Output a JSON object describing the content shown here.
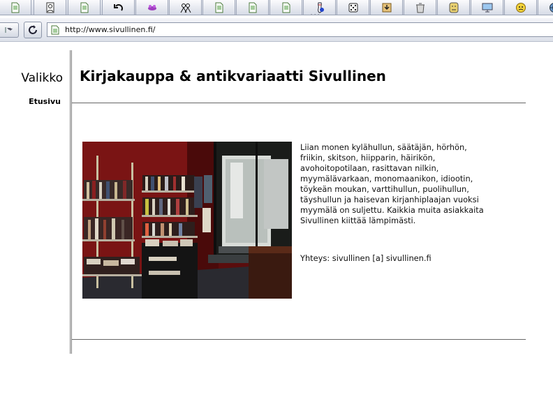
{
  "browser": {
    "address_url": "http://www.sivullinen.fi/"
  },
  "taskbar": {
    "items": [
      {
        "icon": "document-icon"
      },
      {
        "icon": "person-doc-icon"
      },
      {
        "icon": "document-icon"
      },
      {
        "icon": "undo-arrow-icon"
      },
      {
        "icon": "purple-app-icon"
      },
      {
        "icon": "people-icon"
      },
      {
        "icon": "document-icon"
      },
      {
        "icon": "document-icon"
      },
      {
        "icon": "document-icon"
      },
      {
        "icon": "bowling-icon"
      },
      {
        "icon": "dice-icon"
      },
      {
        "icon": "download-icon"
      },
      {
        "icon": "trash-icon"
      },
      {
        "icon": "face-icon"
      },
      {
        "icon": "monitor-icon"
      },
      {
        "icon": "smiley-icon"
      },
      {
        "icon": "globe-icon"
      }
    ]
  },
  "sidebar": {
    "title": "Valikko",
    "items": [
      {
        "label": "Etusivu"
      }
    ]
  },
  "main": {
    "title": "Kirjakauppa & antikvariaatti Sivullinen",
    "intro_lines": [
      "Liian monen kylähullun, säätäjän, hörhön,",
      "friikin, skitson, hiipparin, häirikön,",
      "avohoitopotilaan, rasittavan nilkin,",
      "myymälävarkaan, monomaanikon, idiootin,",
      "töykeän moukan, varttihullun, puolihullun,",
      "täyshullun ja haisevan kirjanhiplaajan vuoksi",
      "myymälä on suljettu. Kaikkia muita asiakkaita",
      "Sivullinen kiittää lämpimästi."
    ],
    "contact": "Yhteys: sivullinen [a] sivullinen.fi"
  },
  "colors": {
    "shop_wall_red": "#7a1414",
    "link_color": "#000000"
  }
}
